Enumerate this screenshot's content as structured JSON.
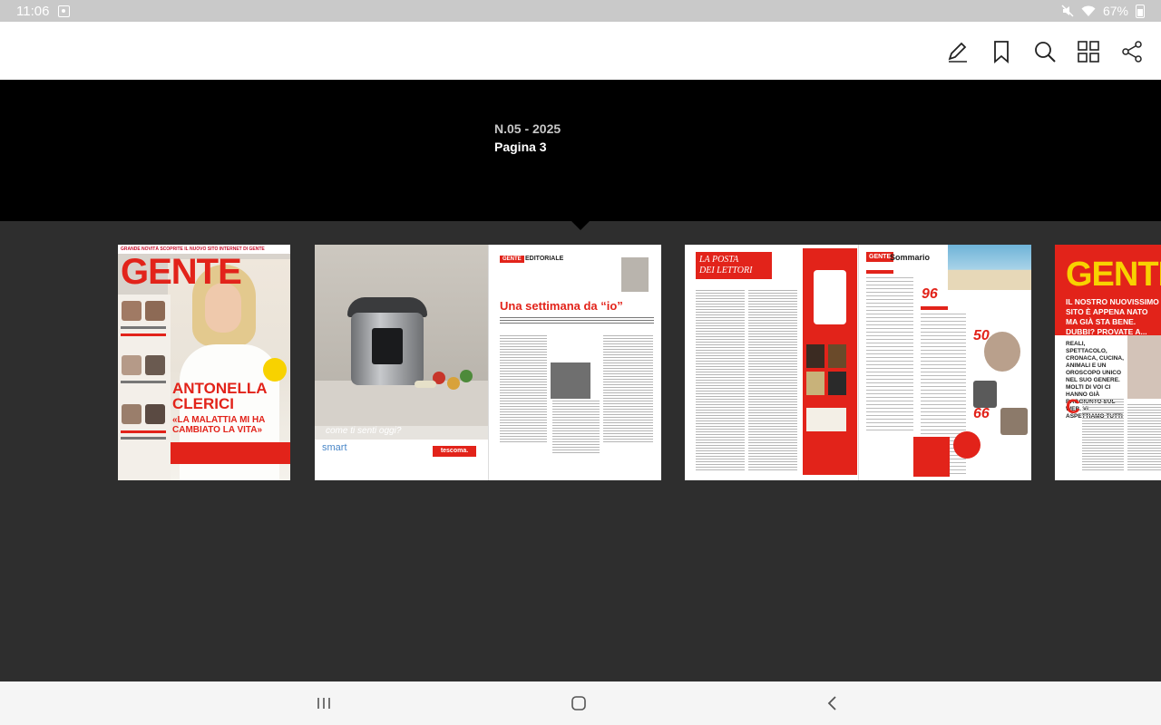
{
  "status_bar": {
    "time": "11:06",
    "battery_text": "67%",
    "icons": [
      "notification-icon",
      "mute-icon",
      "wifi-icon",
      "battery-icon"
    ]
  },
  "toolbar": {
    "icons": [
      "annotate-icon",
      "bookmark-icon",
      "search-icon",
      "grid-view-icon",
      "share-icon"
    ]
  },
  "header": {
    "issue": "N.05 - 2025",
    "page": "Pagina 3"
  },
  "cover": {
    "top_strip": "GRANDE NOVITÀ SCOPRITE IL NUOVO SITO INTERNET DI GENTE",
    "logo": "GENTE",
    "headline_1": "ANTONELLA",
    "headline_2": "CLERICI",
    "quote_1": "«LA MALATTIA MI HA",
    "quote_2": "CAMBIATO LA VITA»"
  },
  "editorial": {
    "tag": "GENTE",
    "section": "EDITORIALE",
    "title": "Una settimana da “io”",
    "ad_brand": "smart",
    "ad_logo": "tescoma.",
    "ad_script": "come ti senti oggi?"
  },
  "letters": {
    "title_line1": "LA POSTA",
    "title_line2": "DEI LETTORI"
  },
  "sommario": {
    "logo": "GENTE",
    "title": "Sommario",
    "pages": [
      "96",
      "50",
      "66"
    ]
  },
  "next_page": {
    "logo": "GENTE",
    "subtitle": "IL NOSTRO NUOVISSIMO SITO È APPENA NATO MA GIÀ STA BENE. DUBBI? PROVATE A...",
    "lead": "REALI, SPETTACOLO, CRONACA, CUCINA, ANIMALI E UN OROSCOPO UNICO NEL SUO GENERE. MOLTI DI VOI CI HANNO GIÀ RAGGIUNTO SUL WEB. VI ASPETTIAMO TUTTI",
    "drop_cap": "C"
  },
  "nav": {
    "icons": [
      "recent-apps-icon",
      "home-icon",
      "back-icon"
    ]
  }
}
